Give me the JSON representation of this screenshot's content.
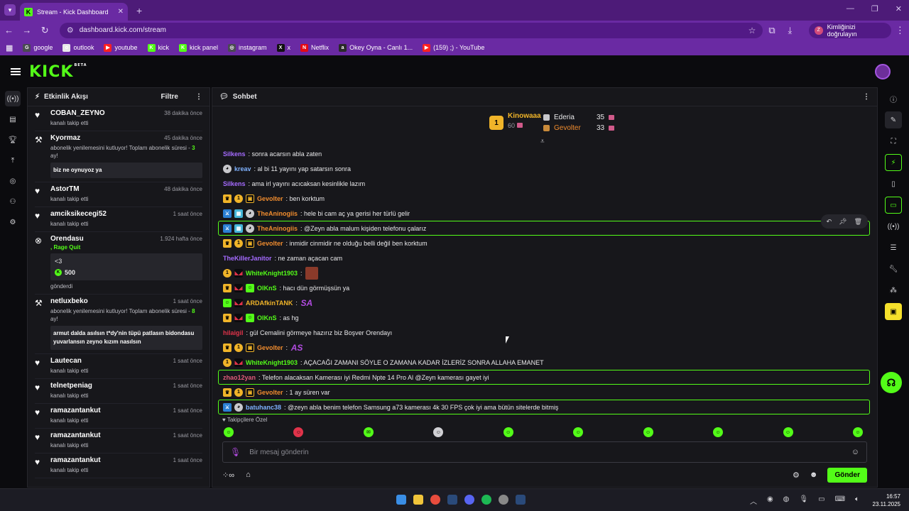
{
  "browser": {
    "tab_title": "Stream - Kick Dashboard",
    "url": "dashboard.kick.com/stream",
    "verify_label": "Kimliğinizi doğrulayın",
    "verify_avatar": "Z",
    "bookmarks": [
      {
        "label": "google",
        "color": "#4a4a52",
        "glyph": "G"
      },
      {
        "label": "outlook",
        "color": "#e8e8ea",
        "glyph": "o"
      },
      {
        "label": "youtube",
        "color": "#ff2020",
        "glyph": "▶"
      },
      {
        "label": "kick",
        "color": "#53fc18",
        "glyph": "K"
      },
      {
        "label": "kick panel",
        "color": "#53fc18",
        "glyph": "K"
      },
      {
        "label": "instagram",
        "color": "#4a4a52",
        "glyph": "◎"
      },
      {
        "label": "x",
        "color": "#111",
        "glyph": "X"
      },
      {
        "label": "Netflix",
        "color": "#e50914",
        "glyph": "N"
      },
      {
        "label": "Okey Oyna - Canlı 1...",
        "color": "#2a2a2a",
        "glyph": "a"
      },
      {
        "label": "(159) ;) - YouTube",
        "color": "#ff2020",
        "glyph": "▶"
      }
    ]
  },
  "app": {
    "logo": "KICK",
    "beta": "BETA"
  },
  "events": {
    "title": "Etkinlik Akışı",
    "filter_label": "Filtre",
    "items": [
      {
        "kind": "follow",
        "name": "COBAN_ZEYNO",
        "time": "38 dakika önce",
        "sub": "kanalı takip etti"
      },
      {
        "kind": "sub",
        "name": "Kyormaz",
        "time": "45 dakika önce",
        "sub_pre": "abonelik yenilemesini kutluyor! Toplam abonelik süresi - ",
        "sub_num": "3",
        "sub_post": " ay!",
        "message": "biz ne oynuyoz ya"
      },
      {
        "kind": "follow",
        "name": "AstorTM",
        "time": "48 dakika önce",
        "sub": "kanalı takip etti"
      },
      {
        "kind": "follow",
        "name": "amciksikecegi52",
        "time": "1 saat önce",
        "sub": "kanalı takip etti"
      },
      {
        "kind": "tip",
        "name": "Orendasu",
        "time": "1.924 hafta önce",
        "rq": ", Rage Quit",
        "message": "<3",
        "amount": "500",
        "sub": "gönderdi"
      },
      {
        "kind": "sub",
        "name": "netluxbeko",
        "time": "1 saat önce",
        "sub_pre": "abonelik yenilemesini kutluyor! Toplam abonelik süresi - ",
        "sub_num": "8",
        "sub_post": " ay!",
        "message": "armut dalda asılsın t*dy'nin tüpü patlasın bidondasu yuvarlansın zeyno kızım nasılsın"
      },
      {
        "kind": "follow",
        "name": "Lautecan",
        "time": "1 saat önce",
        "sub": "kanalı takip etti"
      },
      {
        "kind": "follow",
        "name": "telnetpeniag",
        "time": "1 saat önce",
        "sub": "kanalı takip etti"
      },
      {
        "kind": "follow",
        "name": "ramazantankut",
        "time": "1 saat önce",
        "sub": "kanalı takip etti"
      },
      {
        "kind": "follow",
        "name": "ramazantankut",
        "time": "1 saat önce",
        "sub": "kanalı takip etti"
      },
      {
        "kind": "follow",
        "name": "ramazantankut",
        "time": "1 saat önce",
        "sub": "kanalı takip etti"
      }
    ]
  },
  "chat": {
    "title": "Sohbet",
    "leader": {
      "first": {
        "rank": "1",
        "name": "Kinowaaa",
        "count": "60"
      },
      "second": {
        "name": "Ederia",
        "count": "35"
      },
      "third": {
        "name": "Gevolter",
        "count": "33"
      }
    },
    "messages": [
      {
        "badges": [],
        "user": "Silkens",
        "color": "#a56bff",
        "text": "sonra acarsın abla zaten"
      },
      {
        "badges": [
          "cat"
        ],
        "user": "kreav",
        "color": "#7fb2ff",
        "text": "al bi 11 yayını yap satarsın sonra"
      },
      {
        "badges": [],
        "user": "Silkens",
        "color": "#a56bff",
        "text": "ama irl yayını acıcaksan kesinlikle lazım"
      },
      {
        "badges": [
          "crown",
          "one",
          "gift2"
        ],
        "user": "Gevolter",
        "color": "#f08c2e",
        "text": "ben korktum"
      },
      {
        "badges": [
          "sword",
          "grid",
          "cat"
        ],
        "user": "TheAninogiis",
        "color": "#f08c2e",
        "text": "hele bi cam aç ya gerisi her türlü gelir"
      },
      {
        "badges": [
          "sword",
          "grid",
          "cat"
        ],
        "user": "TheAninogiis",
        "color": "#f08c2e",
        "text": "@Zeyn abla malum kişiden telefonu çalarız",
        "hl": true,
        "hover": true
      },
      {
        "badges": [
          "crown",
          "one",
          "gift2"
        ],
        "user": "Gevolter",
        "color": "#f08c2e",
        "text": "inmidir cinmidir ne olduğu belli değil ben korktum"
      },
      {
        "badges": [],
        "user": "TheKillerJanitor",
        "color": "#a56bff",
        "text": "ne zaman açacan cam"
      },
      {
        "badges": [
          "one",
          "red"
        ],
        "user": "WhiteKnight1903",
        "color": "#53fc18",
        "text": "",
        "emote": "img"
      },
      {
        "badges": [
          "crown",
          "red",
          "green"
        ],
        "user": "OlKnS",
        "color": "#53fc18",
        "text": "hacı dün görmüşsün ya"
      },
      {
        "badges": [
          "green",
          "red"
        ],
        "user": "ARDAfkinTANK",
        "color": "#f0b429",
        "text": "",
        "emote": "SA"
      },
      {
        "badges": [
          "crown",
          "red",
          "green"
        ],
        "user": "OlKnS",
        "color": "#53fc18",
        "text": "as hg"
      },
      {
        "badges": [],
        "user": "hilaigil",
        "color": "#e0334a",
        "text": "gül Cemalini görmeye hazırız biz Boşver Orendayı"
      },
      {
        "badges": [
          "crown",
          "one",
          "gift2"
        ],
        "user": "Gevolter",
        "color": "#f08c2e",
        "text": "",
        "emote": "AS"
      },
      {
        "badges": [
          "one",
          "red"
        ],
        "user": "WhiteKnight1903",
        "color": "#53fc18",
        "text": "AÇACAĞI ZAMANI SÖYLE O ZAMANA KADAR İZLERİZ SONRA ALLAHA EMANET"
      },
      {
        "badges": [],
        "user": "zhao12yan",
        "color": "#e05a7a",
        "text": "Telefon alacaksan Kamerası iyi Redmi Npte 14 Pro Al @Zeyn kamerası gayet iyi",
        "hl": true
      },
      {
        "badges": [
          "crown",
          "one",
          "gift2"
        ],
        "user": "Gevolter",
        "color": "#f08c2e",
        "text": "1 ay süren var"
      },
      {
        "badges": [
          "sword",
          "cat"
        ],
        "user": "batuhanc38",
        "color": "#7fb2ff",
        "text": "@zeyn abla benim telefon Samsung a73 kamerası 4k 30 FPS çok iyi ama bütün sitelerde bitmiş",
        "hl": true
      }
    ],
    "follow_only": "Takipçilere Özel",
    "input_placeholder": "Bir mesaj gönderin",
    "send_label": "Gönder"
  },
  "taskbar": {
    "time": "16:57",
    "date": "23.11.2025"
  }
}
